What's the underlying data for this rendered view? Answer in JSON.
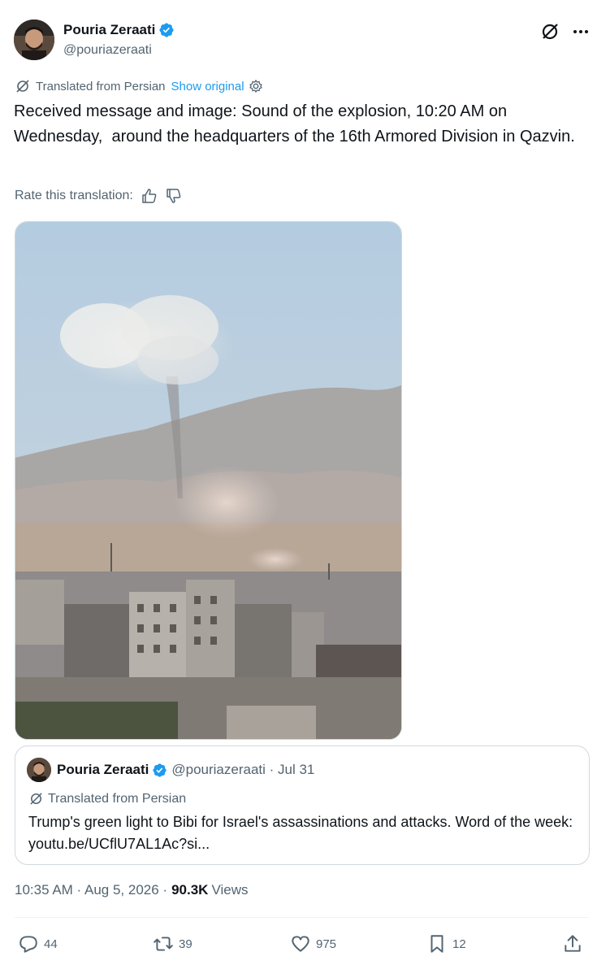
{
  "author": {
    "name": "Pouria Zeraati",
    "handle": "@pouriazeraati"
  },
  "translation": {
    "label": "Translated from Persian",
    "show_original": "Show original"
  },
  "tweet": {
    "text": "Received message and image: Sound of the explosion, 10:20 AM on Wednesday,  around the headquarters of the 16th Armored Division in Qazvin."
  },
  "rate": {
    "label": "Rate this translation:"
  },
  "quote": {
    "name": "Pouria Zeraati",
    "meta": "@pouriazeraati · Jul 31",
    "translated_label": "Translated from Persian",
    "text": "Trump's green light to Bibi for Israel's assassinations and attacks. Word of the week: youtu.be/UCflU7AL1Ac?si..."
  },
  "meta": {
    "timestamp": "10:35 AM · Aug 5, 2026 ·",
    "views_count": "90.3K",
    "views_label": "Views"
  },
  "actions": {
    "replies": "44",
    "reposts": "39",
    "likes": "975",
    "bookmarks": "12"
  },
  "colors": {
    "accent": "#1d9bf0",
    "secondary_text": "#536471",
    "primary_text": "#0f1419"
  },
  "icons": [
    "verified-badge-icon",
    "grok-icon",
    "more-icon",
    "translate-icon",
    "gear-icon",
    "thumbs-up-icon",
    "thumbs-down-icon",
    "reply-icon",
    "repost-icon",
    "like-icon",
    "bookmark-icon",
    "share-icon"
  ]
}
